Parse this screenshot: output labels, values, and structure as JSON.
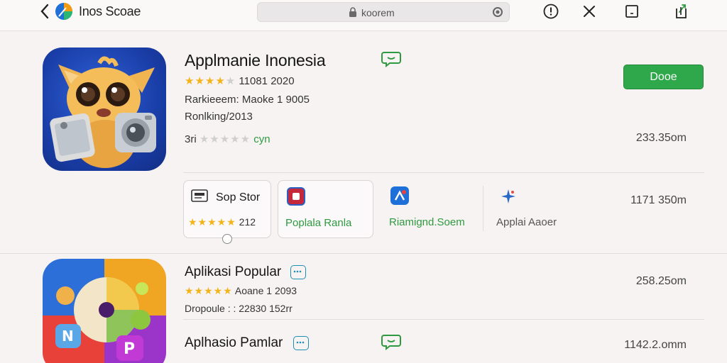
{
  "topbar": {
    "app_name": "Inos Scoae",
    "url": "koorem"
  },
  "featured": {
    "title": "Applmanie Inonesia",
    "rating_text": "11081 2020",
    "line2": "Rarkieeem: Maoke 1 9005",
    "line3": "Ronlking/2013",
    "line4_prefix": "3ri",
    "line4_suffix": "cyn",
    "action_label": "Dooe",
    "size": "233.35om"
  },
  "related": {
    "cards": [
      {
        "title": "Sop Stor",
        "rating": "212"
      },
      {
        "title": "Poplala Ranla"
      },
      {
        "title": "Riamignd.Soem"
      },
      {
        "title": "Applai Aaoer"
      }
    ],
    "size": "1171 350m"
  },
  "list": [
    {
      "title": "Aplikasi Popular",
      "rating_text": "Aoane 1 2093",
      "sub": "Dropoule : : 22830 152rr",
      "size": "258.25om"
    },
    {
      "title": "Aplhasio Pamlar",
      "size": "1142.2.omm"
    }
  ]
}
